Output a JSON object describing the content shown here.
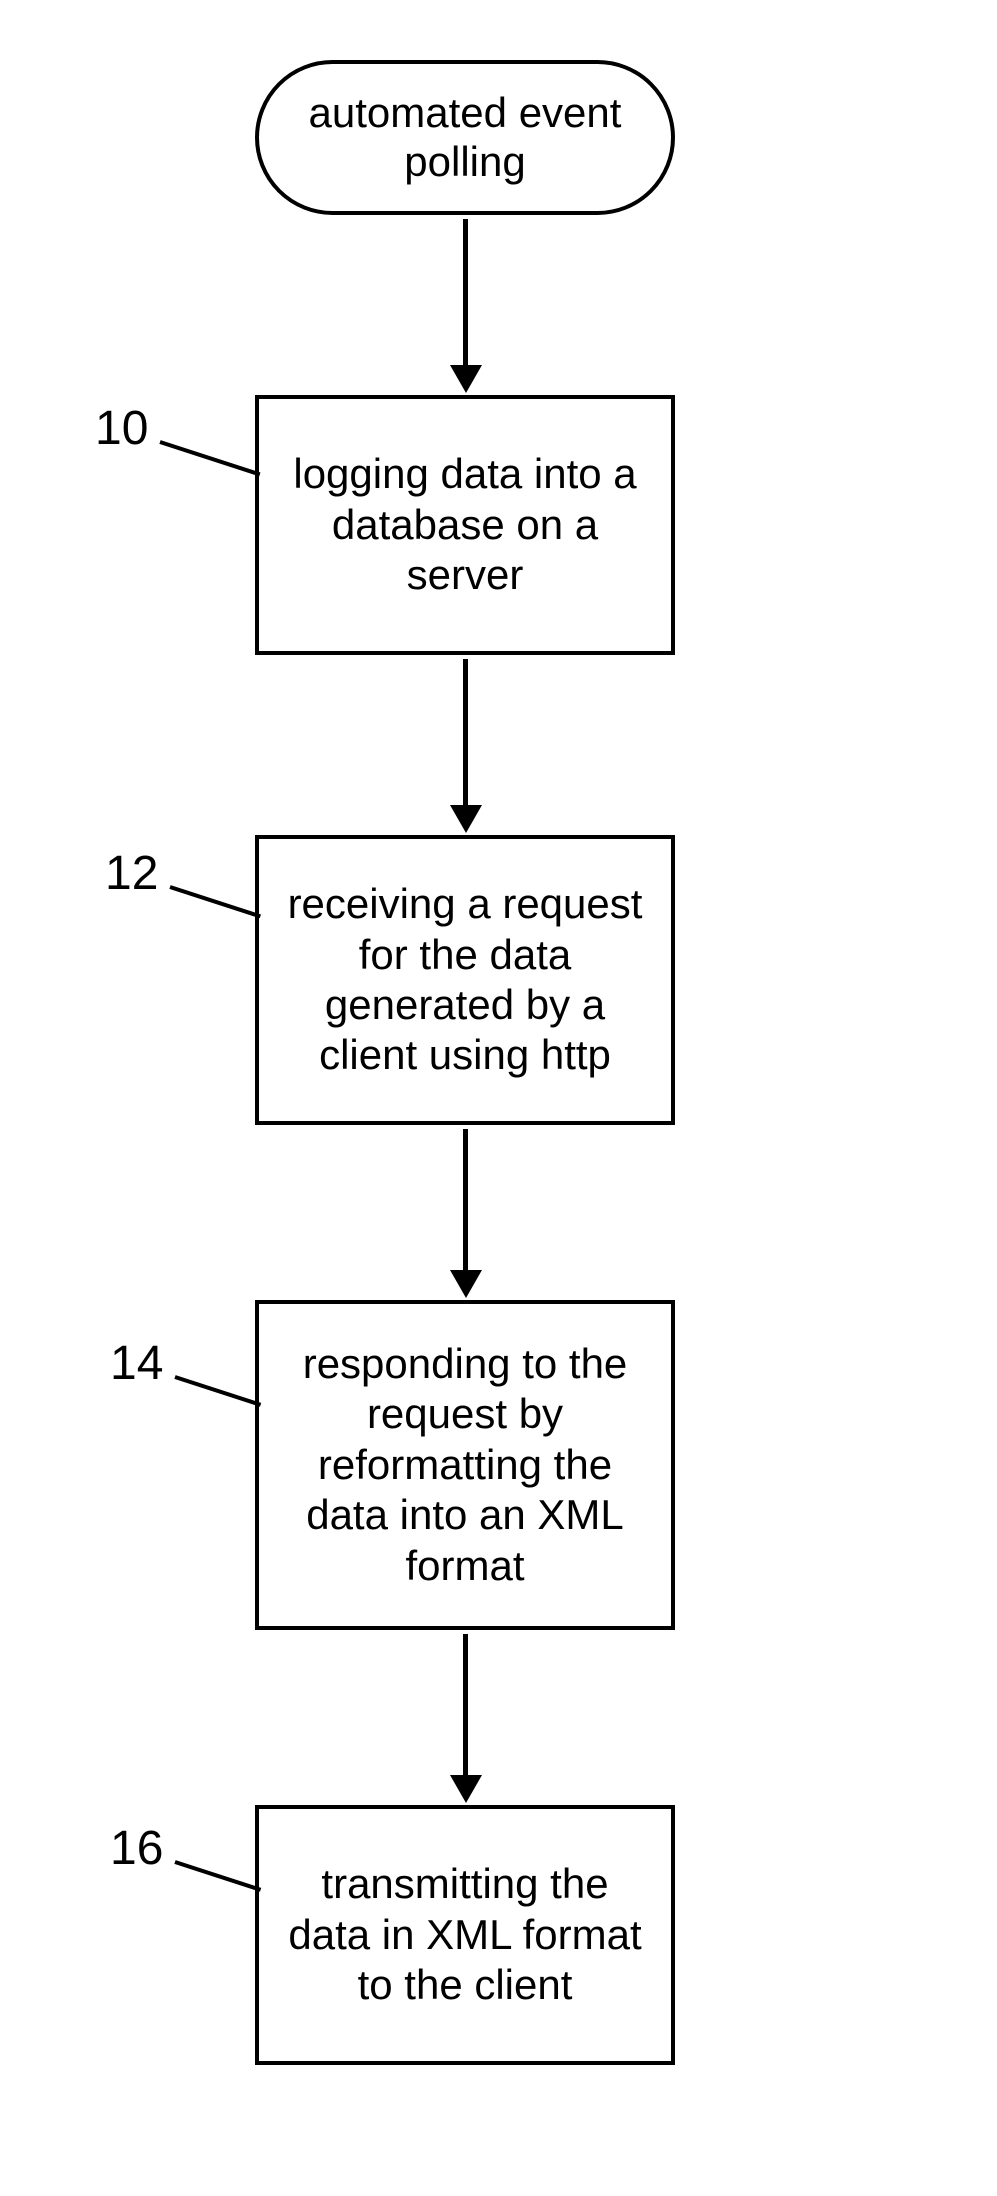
{
  "terminator": {
    "text": "automated event polling"
  },
  "step1": {
    "label": "10",
    "text": "logging data into a database on a server"
  },
  "step2": {
    "label": "12",
    "text": "receiving a request for the data generated by a client using http"
  },
  "step3": {
    "label": "14",
    "text": "responding to the request by reformatting the data into an XML format"
  },
  "step4": {
    "label": "16",
    "text": "transmitting the data in XML format to the client"
  }
}
